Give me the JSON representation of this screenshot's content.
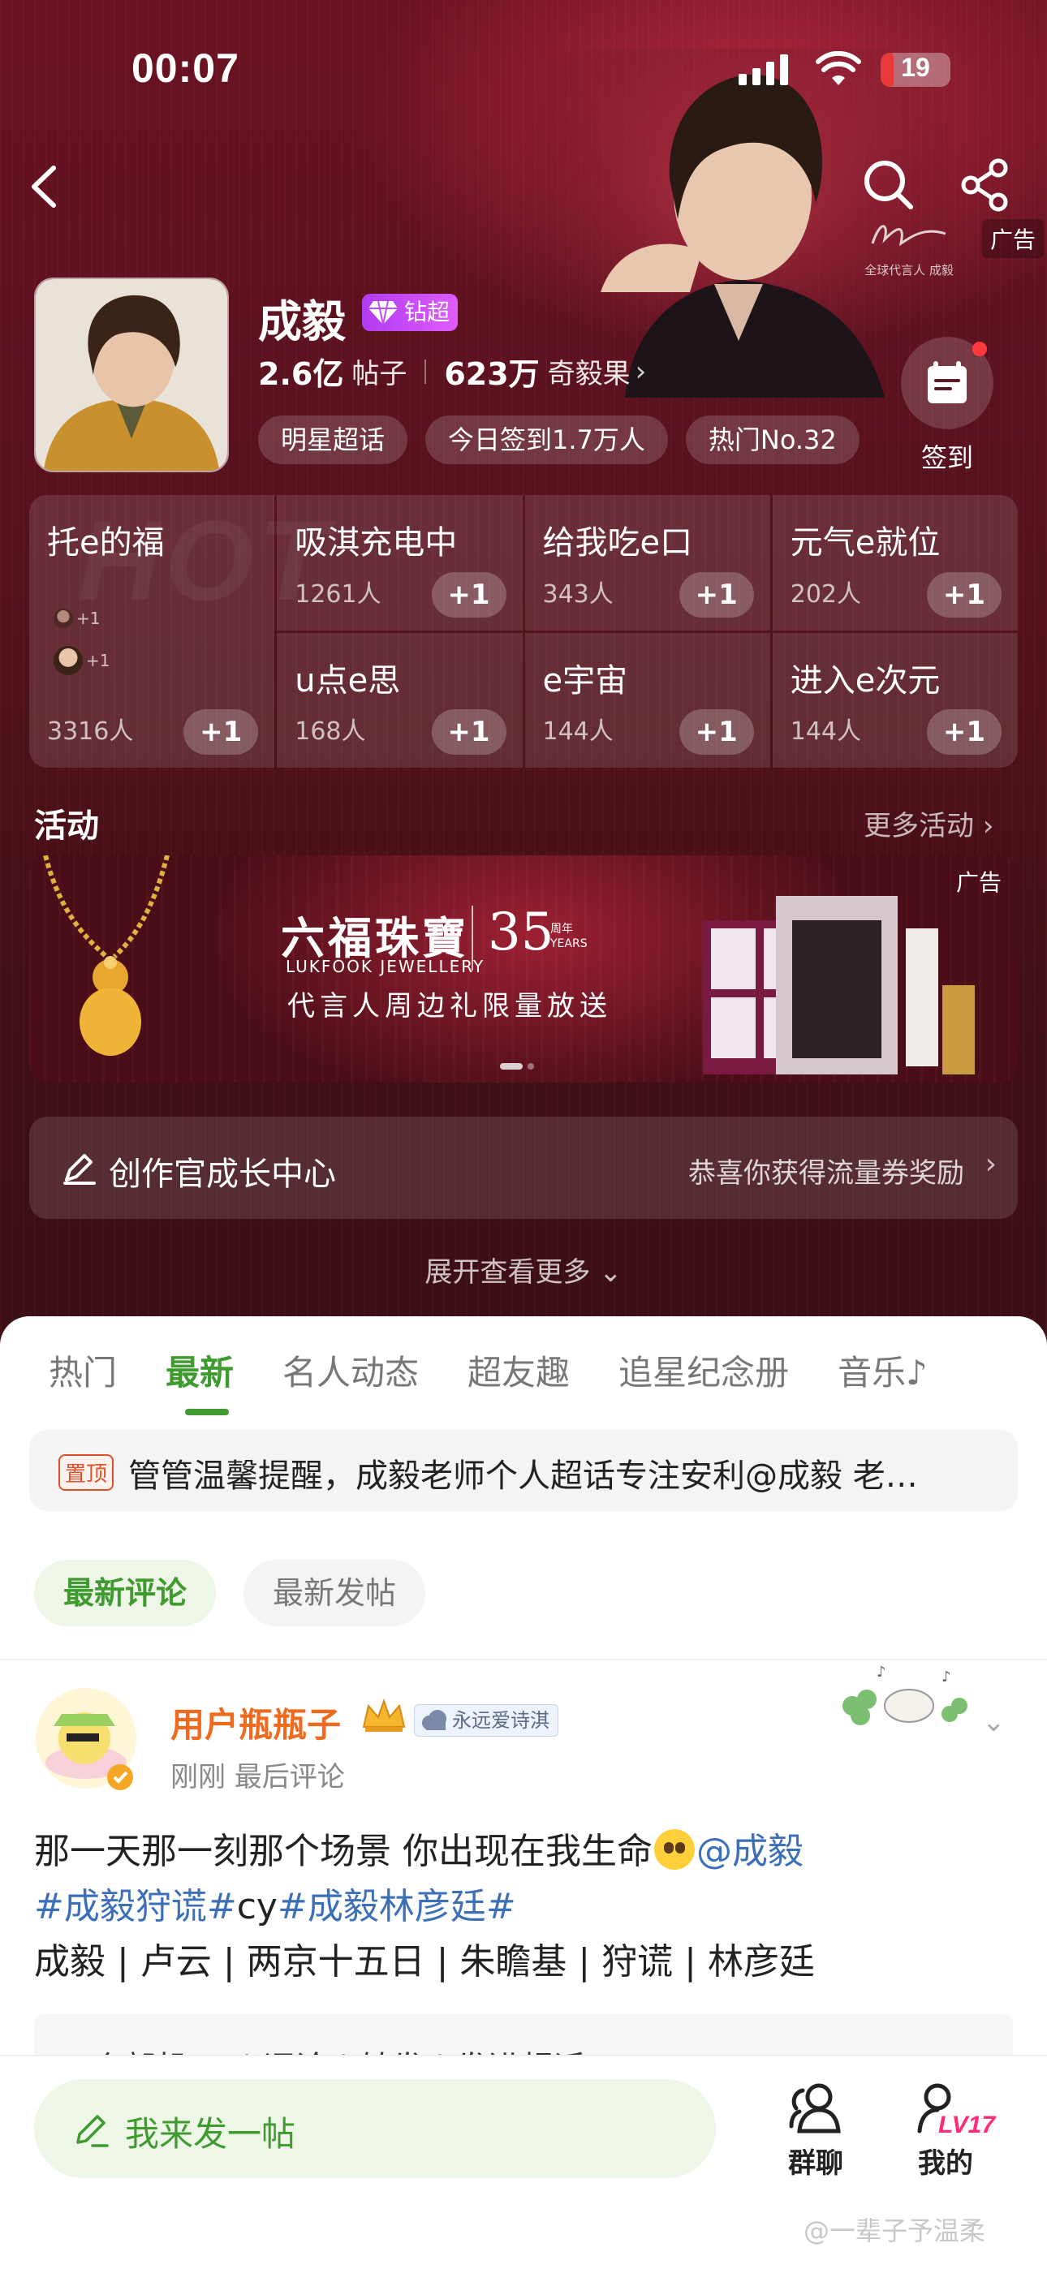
{
  "status_bar": {
    "time": "00:07",
    "battery": "19",
    "battery_level": 0.19
  },
  "header": {
    "ad_label": "广告",
    "ambassador_caption": "全球代言人 成毅",
    "name": "成毅",
    "diamond_badge": "钻超",
    "posts_count": "2.6亿",
    "posts_label": "帖子",
    "fans_count": "623万",
    "fans_label": "奇毅果",
    "chips": [
      "明星超话",
      "今日签到1.7万人",
      "热门No.32"
    ],
    "checkin_label": "签到"
  },
  "grid": {
    "watermark": "HOT",
    "cells": [
      {
        "title": "托e的福",
        "count": "3316人",
        "plus": "+1"
      },
      {
        "title": "吸淇充电中",
        "count": "1261人",
        "plus": "+1"
      },
      {
        "title": "给我吃e口",
        "count": "343人",
        "plus": "+1"
      },
      {
        "title": "元气e就位",
        "count": "202人",
        "plus": "+1"
      },
      {
        "title": "u点e思",
        "count": "168人",
        "plus": "+1"
      },
      {
        "title": "e宇宙",
        "count": "144人",
        "plus": "+1"
      },
      {
        "title": "进入e次元",
        "count": "144人",
        "plus": "+1"
      }
    ],
    "mini_plus": [
      "+1",
      "+1"
    ]
  },
  "activity": {
    "title": "活动",
    "more": "更多活动",
    "banner": {
      "ad": "广告",
      "brand": "六福珠寶",
      "brand_en": "LUKFOOK JEWELLERY",
      "anniv_num": "35",
      "anniv_sub1": "周年",
      "anniv_sub2": "YEARS",
      "slogan": "代言人周边礼限量放送"
    }
  },
  "creator": {
    "title": "创作官成长中心",
    "reward": "恭喜你获得流量券奖励"
  },
  "expand_label": "展开查看更多",
  "tabs": [
    "热门",
    "最新",
    "名人动态",
    "超友趣",
    "追星纪念册",
    "音乐"
  ],
  "active_tab": "最新",
  "pinned": {
    "tag": "置顶",
    "text": "管管温馨提醒，成毅老师个人超话专注安利@成毅 老…"
  },
  "sort": {
    "latest_comment": "最新评论",
    "latest_post": "最新发帖"
  },
  "post": {
    "user": "用户瓶瓶子",
    "fan_badge": "永远爱诗淇",
    "meta": "刚刚 最后评论",
    "line1": "那一天那一刻那个场景 你出现在我生命",
    "mention": "@成毅",
    "tag1": "#成毅狩谎#",
    "tag_mid": "cy",
    "tag2": "#成毅林彦廷#",
    "line3": "成毅 | 卢云 | 两京十五日 | 朱瞻基  | 狩谎 | 林彦廷",
    "repost_preview": "四个部机 一 | 评论 | 转发 | 发进超话 ‼"
  },
  "bottom": {
    "compose": "我来发一帖",
    "group_chat": "群聊",
    "mine": "我的",
    "level": "LV17"
  },
  "watermark": "@一辈子予温柔",
  "colors": {
    "accent_green": "#3f9a2f",
    "hero_red": "#5a121f",
    "user_orange": "#f06a1e",
    "link_blue": "#3c6fb8"
  }
}
